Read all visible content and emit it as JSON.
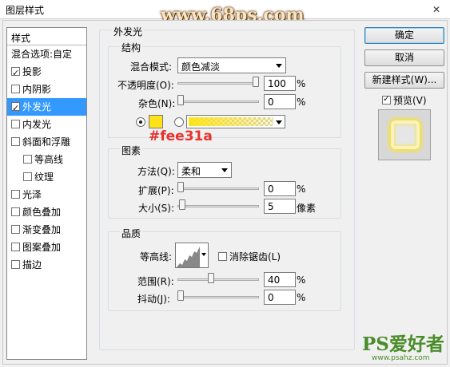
{
  "window": {
    "title": "图层样式",
    "close_glyph": "✕"
  },
  "watermark_top": "www.68ps.com",
  "watermark_bottom": {
    "main": "PS爱好者",
    "url": "www.psahz.com"
  },
  "left_panel": {
    "header": "样式",
    "items": [
      {
        "label": "混合选项:自定",
        "checkbox": false,
        "checked": false
      },
      {
        "label": "投影",
        "checkbox": true,
        "checked": true
      },
      {
        "label": "内阴影",
        "checkbox": true,
        "checked": false
      },
      {
        "label": "外发光",
        "checkbox": true,
        "checked": true,
        "selected": true
      },
      {
        "label": "内发光",
        "checkbox": true,
        "checked": false
      },
      {
        "label": "斜面和浮雕",
        "checkbox": true,
        "checked": false
      },
      {
        "label": "等高线",
        "checkbox": true,
        "checked": false,
        "sub": true
      },
      {
        "label": "纹理",
        "checkbox": true,
        "checked": false,
        "sub": true
      },
      {
        "label": "光泽",
        "checkbox": true,
        "checked": false
      },
      {
        "label": "颜色叠加",
        "checkbox": true,
        "checked": false
      },
      {
        "label": "渐变叠加",
        "checkbox": true,
        "checked": false
      },
      {
        "label": "图案叠加",
        "checkbox": true,
        "checked": false
      },
      {
        "label": "描边",
        "checkbox": true,
        "checked": false
      }
    ]
  },
  "outer_glow": {
    "title": "外发光",
    "structure": {
      "title": "结构",
      "blend_mode_label": "混合模式:",
      "blend_mode_value": "颜色减淡",
      "opacity_label": "不透明度(O):",
      "opacity_value": "100",
      "opacity_unit": "%",
      "opacity_fraction": 1.0,
      "noise_label": "杂色(N):",
      "noise_value": "0",
      "noise_unit": "%",
      "noise_fraction": 0.0,
      "glow_color": "#fee31a",
      "annotation": "#fee31a"
    },
    "elements": {
      "title": "图素",
      "method_label": "方法(Q):",
      "method_value": "柔和",
      "spread_label": "扩展(P):",
      "spread_value": "0",
      "spread_unit": "%",
      "spread_fraction": 0.0,
      "size_label": "大小(S):",
      "size_value": "5",
      "size_unit": "像素",
      "size_fraction": 0.02
    },
    "quality": {
      "title": "品质",
      "contour_label": "等高线:",
      "anti_alias_label": "消除锯齿(L)",
      "range_label": "范围(R):",
      "range_value": "40",
      "range_unit": "%",
      "range_fraction": 0.4,
      "jitter_label": "抖动(J):",
      "jitter_value": "0",
      "jitter_unit": "%",
      "jitter_fraction": 0.0
    }
  },
  "buttons": {
    "ok": "确定",
    "cancel": "取消",
    "new_style": "新建样式(W)...",
    "preview": "预览(V)"
  },
  "colors": {
    "accent": "#3399ff",
    "annotation_red": "#e8312c",
    "glow": "#fee31a"
  }
}
